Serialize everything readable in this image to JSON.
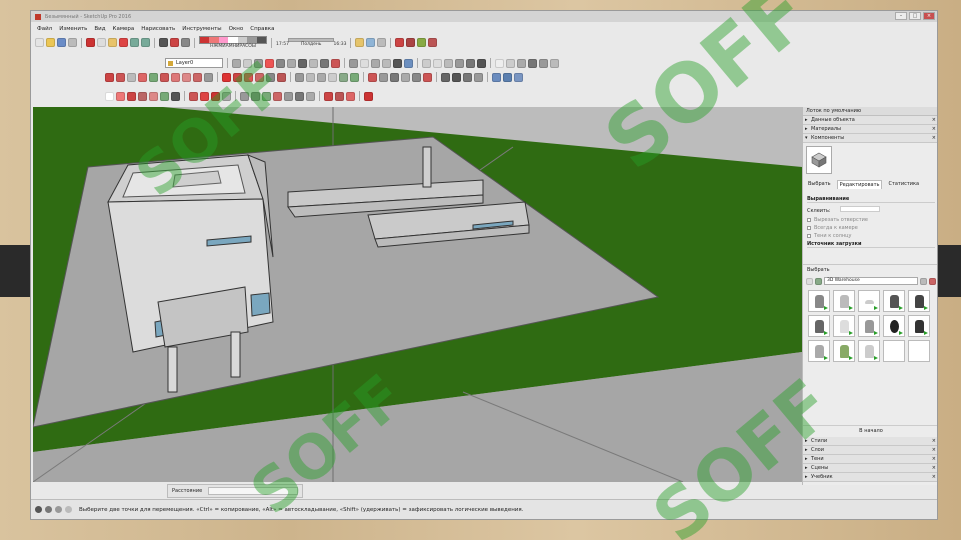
{
  "app": {
    "title": "Безымянный - SketchUp Pro 2016",
    "window_buttons": [
      "–",
      "□",
      "×"
    ]
  },
  "menu": [
    "Файл",
    "Изменить",
    "Вид",
    "Камера",
    "Нарисовать",
    "Инструменты",
    "Окно",
    "Справка"
  ],
  "toolbar": {
    "style_label": "НЖМИАМНИРАСОЫ",
    "slider_left_value": "17:57",
    "slider_mid_label": "Полдень",
    "slider_right_value": "16:33",
    "layer": "Layer0"
  },
  "panel": {
    "title": "Лоток по умолчанию",
    "trays_top": [
      "Данные объекта",
      "Материалы",
      "Компоненты"
    ],
    "tabs": [
      "Выбрать",
      "Редактировать",
      "Статистика"
    ],
    "active_tab": "Редактировать",
    "align_header": "Выравнивание",
    "glue_label": "Склеить:",
    "options": [
      "Вырезать отверстие",
      "Всегда к камере",
      "Тени к солнцу"
    ],
    "source_header": "Источник загрузки",
    "select_label": "Выбрать",
    "search_text": "3D Warehouse",
    "pager": "В начало",
    "trays_bottom": [
      "Стили",
      "Слои",
      "Тени",
      "Сцены",
      "Учебник"
    ]
  },
  "measurements": {
    "label": "Расстояние"
  },
  "status": {
    "text": "Выберите две точки для перемещения. «Ctrl» = копирование, «Alt» = автоскладывание, «Shift» (удерживать) = зафиксировать логические выведения."
  },
  "watermark": "SOFF",
  "colors": {
    "grass": "#2f6b12",
    "ground": "#a7a7a7",
    "building": "#d7d7d7",
    "accent_green": "#2aa02a"
  }
}
